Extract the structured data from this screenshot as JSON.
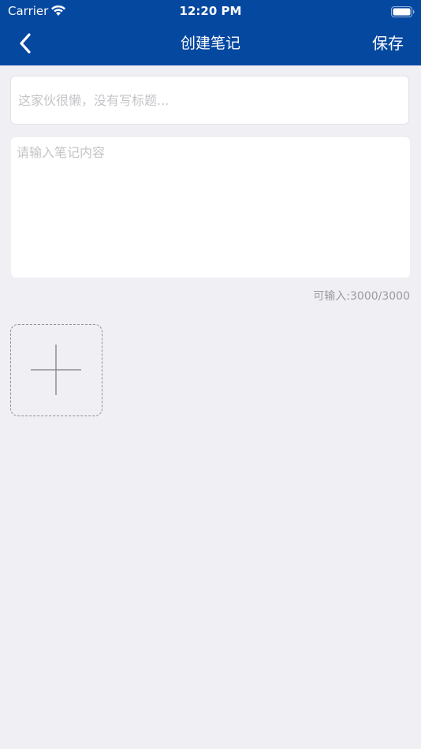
{
  "status_bar": {
    "carrier": "Carrier",
    "time": "12:20 PM",
    "icons": [
      "wifi-icon",
      "battery-icon"
    ]
  },
  "nav_bar": {
    "back_icon": "chevron-left-icon",
    "title": "创建笔记",
    "save_label": "保存",
    "background_color": "#0548a0"
  },
  "form": {
    "title_placeholder": "这家伙很懒，没有写标题...",
    "title_value": "",
    "content_placeholder": "请输入笔记内容",
    "content_value": "",
    "counter_text": "可输入:3000/3000"
  },
  "add_image": {
    "icon": "plus-icon"
  },
  "colors": {
    "page_background": "#efeff4",
    "accent": "#0548a0",
    "placeholder": "#c4c4c8",
    "counter": "#9b9b9f"
  }
}
